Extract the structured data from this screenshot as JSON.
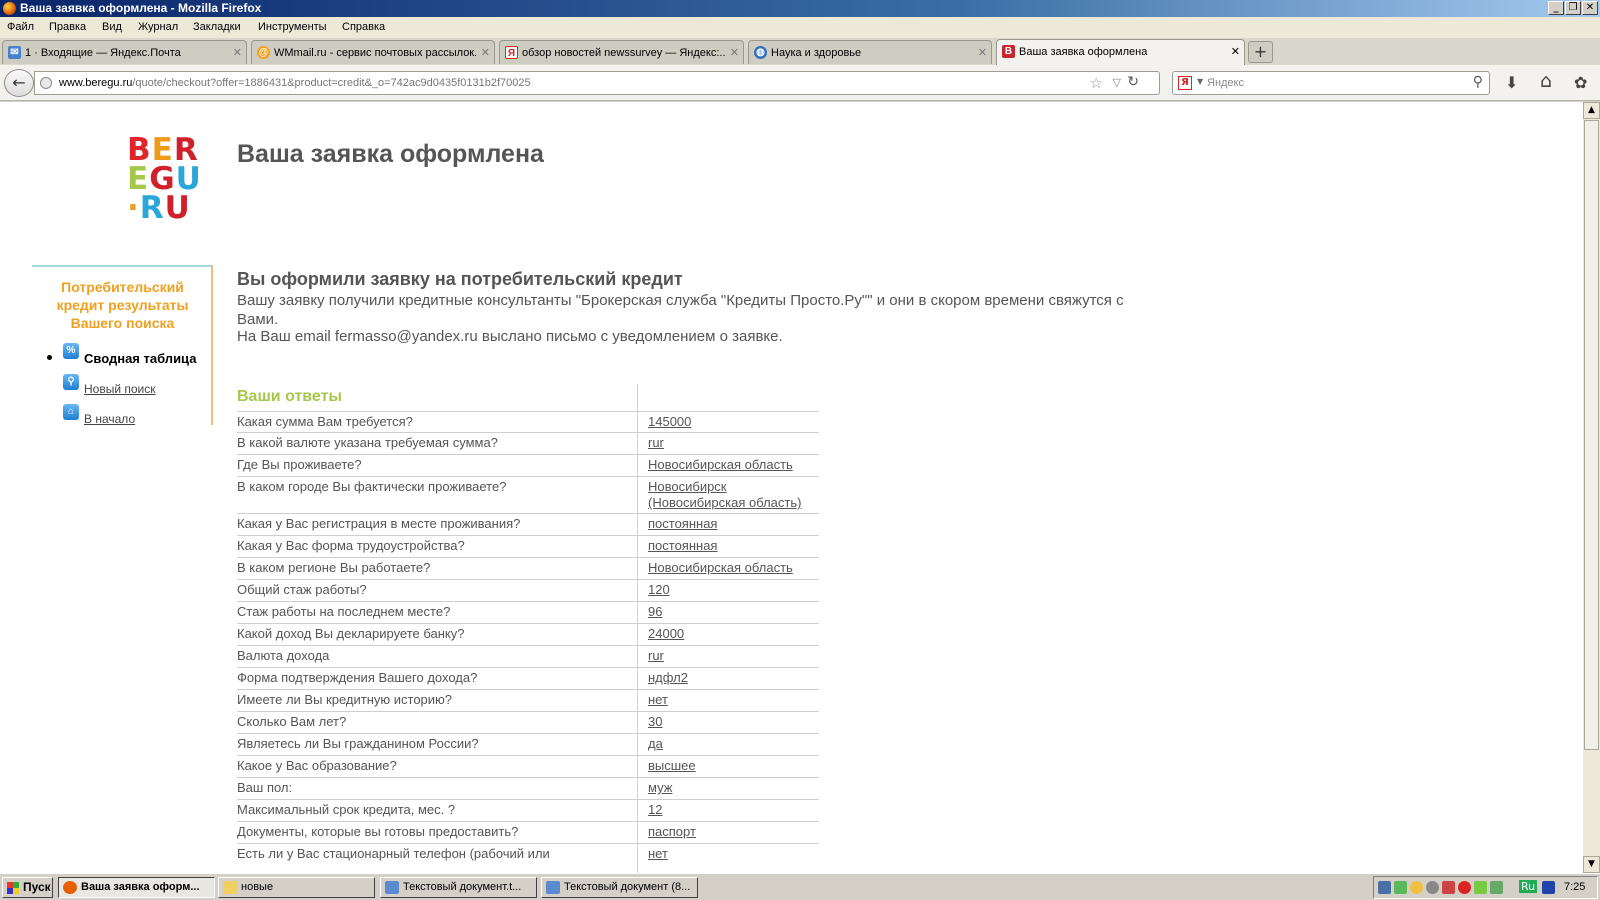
{
  "window": {
    "title": "Ваша заявка оформлена - Mozilla Firefox",
    "controls": [
      "_",
      "❐",
      "✕"
    ]
  },
  "menu": [
    "Файл",
    "Правка",
    "Вид",
    "Журнал",
    "Закладки",
    "Инструменты",
    "Справка"
  ],
  "tabs": [
    {
      "label": "1 · Входящие — Яндекс.Почта",
      "icon": "mail-icon",
      "color": "#4a7fd0",
      "active": false
    },
    {
      "label": "WMmail.ru - сервис почтовых рассылок...",
      "icon": "wmmail-icon",
      "color": "#f0a020",
      "active": false
    },
    {
      "label": "обзор новостей newssurvey — Яндекс:...",
      "icon": "yandex-icon",
      "color": "#d22222",
      "active": false
    },
    {
      "label": "Наука и здоровье",
      "icon": "globe-icon",
      "color": "#3070c0",
      "active": false
    },
    {
      "label": "Ваша заявка оформлена",
      "icon": "beregu-icon",
      "color": "#c8262e",
      "active": true
    }
  ],
  "newtab_label": "+",
  "tab_close": "✕",
  "nav": {
    "back": "←",
    "url_domain": "www.beregu.ru",
    "url_path": "/quote/checkout?offer=1886431&product=credit&_o=742ac9d0435f0131b2f70025",
    "search_engine_glyph": "Я",
    "search_placeholder": "Яндекс",
    "star": "☆",
    "dropmarker": "▽",
    "reload": "↻",
    "search_btn": "⚲",
    "download": "⬇",
    "home": "⌂",
    "addons": "✿"
  },
  "logo": {
    "rows": [
      [
        {
          "t": "B",
          "c": "#e0262d"
        },
        {
          "t": "E",
          "c": "#f09a1a"
        },
        {
          "t": "R",
          "c": "#d0202a"
        }
      ],
      [
        {
          "t": "E",
          "c": "#a6c84a"
        },
        {
          "t": "G",
          "c": "#d0202a"
        },
        {
          "t": "U",
          "c": "#2aa6d8"
        }
      ],
      [
        {
          "t": "·",
          "c": "#f0a020"
        },
        {
          "t": "R",
          "c": "#2aa6d8"
        },
        {
          "t": "U",
          "c": "#d0202a"
        }
      ]
    ]
  },
  "page": {
    "title": "Ваша заявка оформлена",
    "sidebar": {
      "heading_lines": [
        "Потребительский",
        "кредит результаты",
        "Вашего поиска"
      ],
      "items": [
        {
          "label": "Сводная таблица",
          "icon": "%",
          "active": true
        },
        {
          "label": "Новый поиск",
          "icon": "⚲",
          "active": false
        },
        {
          "label": "В начало",
          "icon": "⌂",
          "active": false
        }
      ]
    },
    "confirmation": {
      "heading": "Вы оформили заявку на потребительский кредит",
      "text": "Вашу заявку получили кредитные консультанты \"Брокерская служба \"Кредиты Просто.Ру\"\" и они в скором времени свяжутся с Вами.",
      "email_line": "На Ваш email fermasso@yandex.ru выслано письмо с уведомлением о заявке."
    },
    "answers": {
      "heading": "Ваши ответы",
      "rows": [
        {
          "q": "Какая сумма Вам требуется?",
          "a": "145000"
        },
        {
          "q": "В какой валюте указана требуемая сумма?",
          "a": "rur"
        },
        {
          "q": "Где Вы проживаете?",
          "a": "Новосибирская область"
        },
        {
          "q": "В каком городе Вы фактически проживаете?",
          "a": "Новосибирск (Новосибирская область)"
        },
        {
          "q": "Какая у Вас регистрация в месте проживания?",
          "a": "постоянная"
        },
        {
          "q": "Какая у Вас форма трудоустройства?",
          "a": "постоянная"
        },
        {
          "q": "В каком регионе Вы работаете?",
          "a": "Новосибирская область"
        },
        {
          "q": "Общий стаж работы?",
          "a": "120"
        },
        {
          "q": "Стаж работы на последнем месте?",
          "a": "96"
        },
        {
          "q": "Какой доход Вы декларируете банку?",
          "a": "24000"
        },
        {
          "q": "Валюта дохода",
          "a": "rur"
        },
        {
          "q": "Форма подтверждения Вашего дохода?",
          "a": "ндфл2"
        },
        {
          "q": "Имеете ли Вы кредитную историю?",
          "a": "нет"
        },
        {
          "q": "Сколько Вам лет?",
          "a": "30"
        },
        {
          "q": "Являетесь ли Вы гражданином России?",
          "a": "да"
        },
        {
          "q": "Какое у Вас образование?",
          "a": "высшее"
        },
        {
          "q": "Ваш пол:",
          "a": "муж"
        },
        {
          "q": "Максимальный срок кредита, мес. ?",
          "a": "12"
        },
        {
          "q": "Документы, которые вы готовы предоставить?",
          "a": "паспорт"
        },
        {
          "q": "Есть ли у Вас стационарный телефон (рабочий или",
          "a": "нет"
        }
      ]
    }
  },
  "taskbar": {
    "start": "Пуск",
    "tasks": [
      {
        "label": "Ваша заявка оформ...",
        "icon_color": "#e66000",
        "active": true
      },
      {
        "label": "новые",
        "icon_color": "#f0d060",
        "active": false
      },
      {
        "label": "Текстовый документ.t...",
        "icon_color": "#5a8ad0",
        "active": false
      },
      {
        "label": "Текстовый документ (8...",
        "icon_color": "#5a8ad0",
        "active": false
      }
    ],
    "tray_lang": "Ru",
    "clock": "7:25"
  },
  "scroll": {
    "up": "▲",
    "down": "▼"
  }
}
